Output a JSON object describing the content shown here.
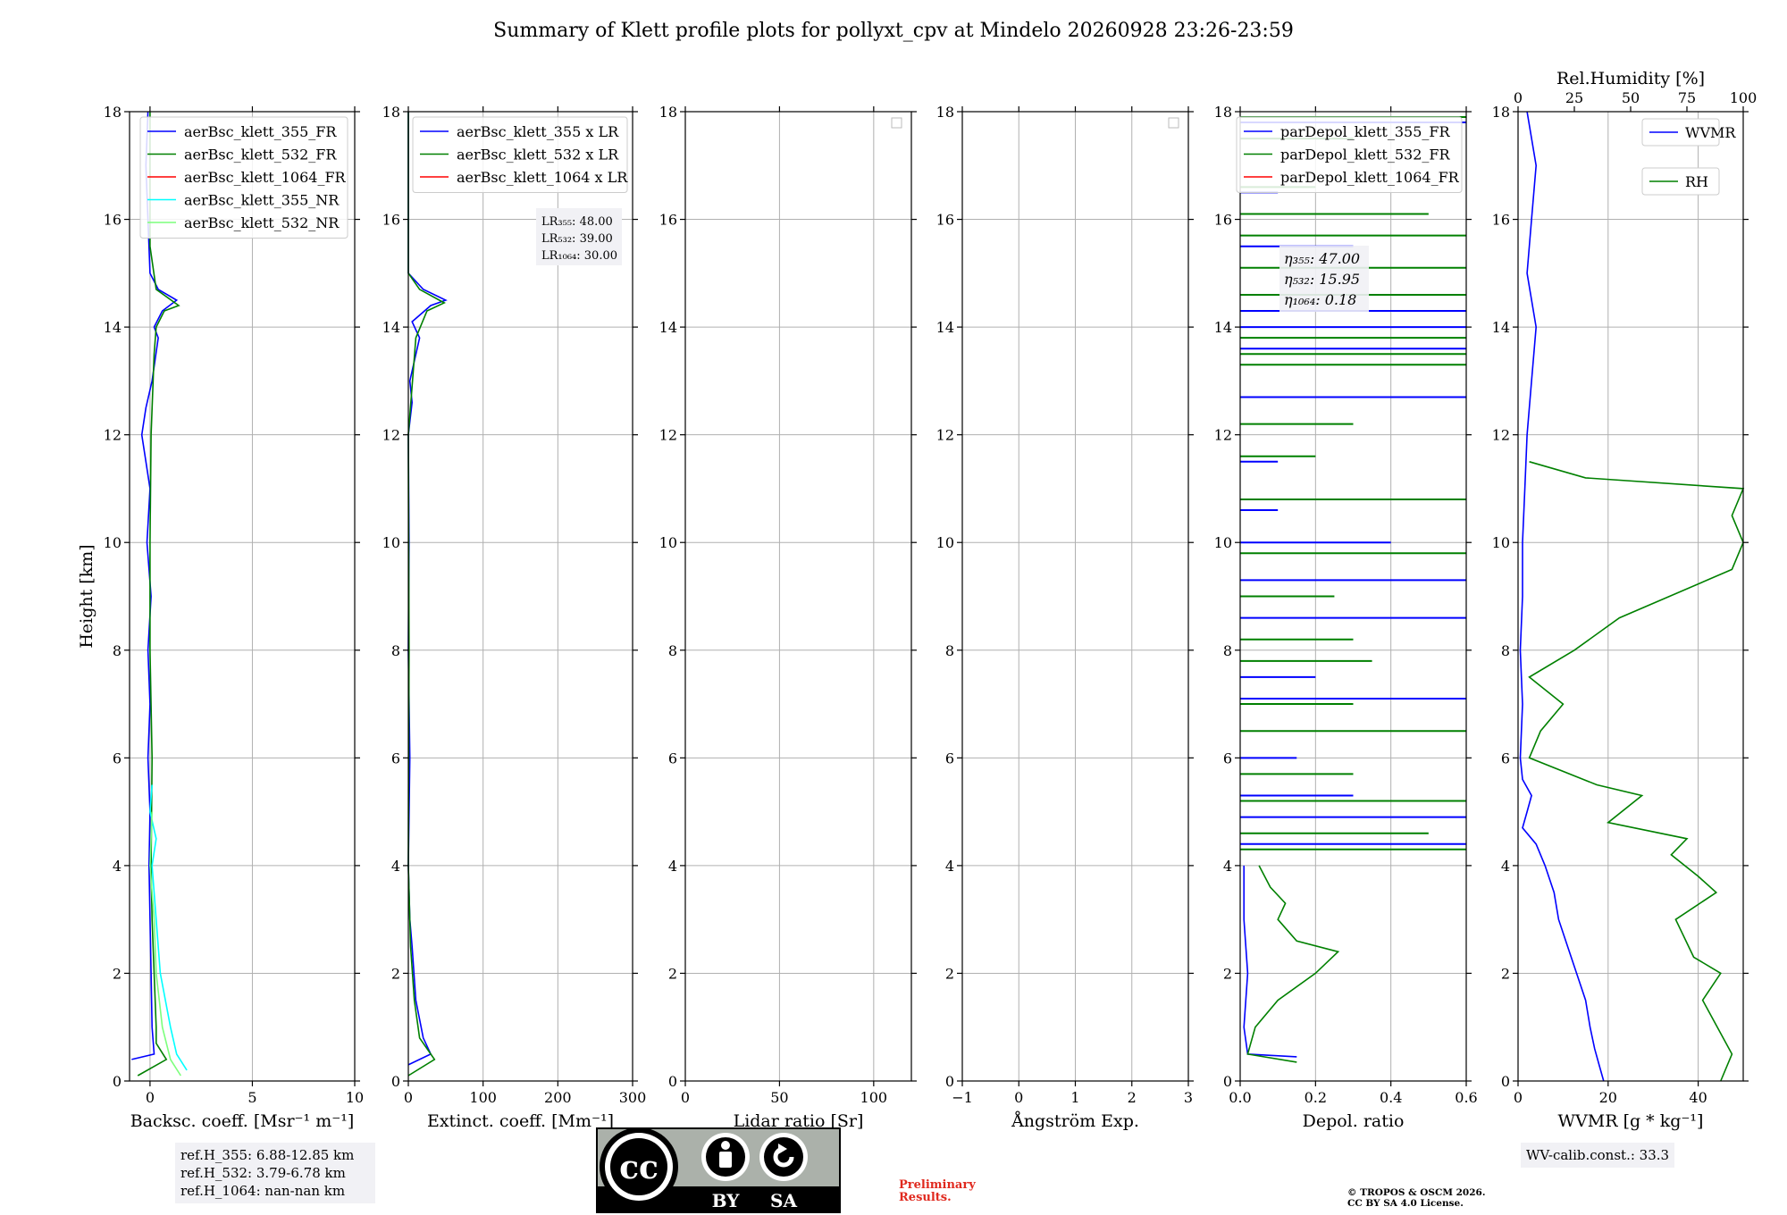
{
  "title": "Summary of Klett profile plots for pollyxt_cpv at Mindelo 20260928 23:26-23:59",
  "ylabel": "Height [km]",
  "chart_data": [
    {
      "type": "line",
      "xlabel": "Backsc. coeff. [Msr⁻¹ m⁻¹]",
      "xlim": [
        -1,
        10
      ],
      "ylim": [
        0,
        18
      ],
      "xticks": [
        "0",
        "5",
        "10"
      ],
      "xtick_values": [
        0,
        5,
        10
      ],
      "yticks": [
        "0",
        "2",
        "4",
        "6",
        "8",
        "10",
        "12",
        "14",
        "16",
        "18"
      ],
      "grid": true,
      "legend_position": "top-right",
      "series": [
        {
          "name": "aerBsc_klett_355_FR",
          "color": "#0000ff",
          "points": [
            [
              -0.9,
              0.4
            ],
            [
              0.2,
              0.5
            ],
            [
              0.1,
              1.0
            ],
            [
              0.05,
              2.0
            ],
            [
              0.0,
              3.0
            ],
            [
              -0.05,
              4.0
            ],
            [
              0.0,
              5.0
            ],
            [
              -0.1,
              6.0
            ],
            [
              0.0,
              7.0
            ],
            [
              -0.1,
              8.0
            ],
            [
              0.05,
              9.0
            ],
            [
              -0.15,
              10.0
            ],
            [
              0.0,
              11.0
            ],
            [
              -0.4,
              12.0
            ],
            [
              -0.2,
              12.5
            ],
            [
              0.1,
              13.0
            ],
            [
              0.4,
              13.8
            ],
            [
              0.2,
              14.0
            ],
            [
              0.6,
              14.3
            ],
            [
              1.3,
              14.5
            ],
            [
              0.4,
              14.7
            ],
            [
              0.0,
              15.0
            ],
            [
              -0.1,
              16.0
            ],
            [
              -0.2,
              17.0
            ],
            [
              -0.1,
              18.0
            ]
          ]
        },
        {
          "name": "aerBsc_klett_532_FR",
          "color": "#008000",
          "points": [
            [
              -0.6,
              0.1
            ],
            [
              0.8,
              0.4
            ],
            [
              0.3,
              0.7
            ],
            [
              0.3,
              1.0
            ],
            [
              0.2,
              2.0
            ],
            [
              0.1,
              3.0
            ],
            [
              0.05,
              4.0
            ],
            [
              0.1,
              6.0
            ],
            [
              0.0,
              8.0
            ],
            [
              0.0,
              10.0
            ],
            [
              0.05,
              12.0
            ],
            [
              0.2,
              13.5
            ],
            [
              0.3,
              14.0
            ],
            [
              0.7,
              14.3
            ],
            [
              1.4,
              14.4
            ],
            [
              0.3,
              14.7
            ],
            [
              0.0,
              15.5
            ],
            [
              0.0,
              18.0
            ]
          ]
        },
        {
          "name": "aerBsc_klett_1064_FR",
          "color": "#ff0000",
          "points": []
        },
        {
          "name": "aerBsc_klett_355_NR",
          "color": "#00ffff",
          "points": [
            [
              1.8,
              0.2
            ],
            [
              1.3,
              0.5
            ],
            [
              1.0,
              1.0
            ],
            [
              0.5,
              2.0
            ],
            [
              0.3,
              3.0
            ],
            [
              0.1,
              4.0
            ],
            [
              0.3,
              4.5
            ],
            [
              0.0,
              5.0
            ],
            [
              0.1,
              5.5
            ]
          ]
        },
        {
          "name": "aerBsc_klett_532_NR",
          "color": "#7cff7c",
          "points": [
            [
              1.5,
              0.1
            ],
            [
              1.0,
              0.4
            ],
            [
              0.6,
              1.0
            ],
            [
              0.3,
              2.0
            ],
            [
              0.2,
              3.0
            ],
            [
              0.0,
              4.0
            ],
            [
              0.1,
              5.0
            ]
          ]
        }
      ],
      "annotation_lines": [
        "ref.H_355: 6.88-12.85 km",
        "ref.H_532: 3.79-6.78 km",
        "ref.H_1064: nan-nan km"
      ]
    },
    {
      "type": "line",
      "xlabel": "Extinct. coeff. [Mm⁻¹]",
      "xlim": [
        0,
        300
      ],
      "ylim": [
        0,
        18
      ],
      "xticks": [
        "0",
        "100",
        "200",
        "300"
      ],
      "xtick_values": [
        0,
        100,
        200,
        300
      ],
      "yticks": [
        "0",
        "2",
        "4",
        "6",
        "8",
        "10",
        "12",
        "14",
        "16",
        "18"
      ],
      "grid": true,
      "legend_position": "top-right",
      "series": [
        {
          "name": "aerBsc_klett_355 x LR",
          "color": "#0000ff",
          "points": [
            [
              0,
              0.3
            ],
            [
              30,
              0.5
            ],
            [
              20,
              0.8
            ],
            [
              10,
              1.5
            ],
            [
              5,
              2.5
            ],
            [
              2,
              3.0
            ],
            [
              0,
              4.0
            ],
            [
              2,
              6.0
            ],
            [
              0,
              8.0
            ],
            [
              1,
              10.0
            ],
            [
              0,
              12.0
            ],
            [
              5,
              12.6
            ],
            [
              2,
              13.0
            ],
            [
              15,
              13.8
            ],
            [
              5,
              14.1
            ],
            [
              30,
              14.4
            ],
            [
              50,
              14.5
            ],
            [
              20,
              14.7
            ],
            [
              0,
              15.0
            ],
            [
              0,
              18.0
            ]
          ]
        },
        {
          "name": "aerBsc_klett_532 x LR",
          "color": "#008000",
          "points": [
            [
              0,
              0.1
            ],
            [
              35,
              0.4
            ],
            [
              15,
              0.8
            ],
            [
              8,
              1.5
            ],
            [
              3,
              2.5
            ],
            [
              0,
              4.0
            ],
            [
              1,
              8.0
            ],
            [
              0,
              12.0
            ],
            [
              10,
              13.8
            ],
            [
              25,
              14.3
            ],
            [
              48,
              14.45
            ],
            [
              15,
              14.7
            ],
            [
              0,
              15.0
            ],
            [
              0,
              18.0
            ]
          ]
        },
        {
          "name": "aerBsc_klett_1064 x LR",
          "color": "#ff0000",
          "points": []
        }
      ],
      "lidar_ratios": [
        "LR₃₅₅: 48.00",
        "LR₅₃₂: 39.00",
        "LR₁₀₆₄: 30.00"
      ]
    },
    {
      "type": "line",
      "xlabel": "Lidar ratio [Sr]",
      "xlim": [
        0,
        120
      ],
      "ylim": [
        0,
        18
      ],
      "xticks": [
        "0",
        "50",
        "100"
      ],
      "xtick_values": [
        0,
        50,
        100
      ],
      "yticks": [
        "0",
        "2",
        "4",
        "6",
        "8",
        "10",
        "12",
        "14",
        "16",
        "18"
      ],
      "grid": true,
      "legend_position": "top-right",
      "series": []
    },
    {
      "type": "line",
      "xlabel": "Ångström Exp.",
      "xlim": [
        -1,
        3
      ],
      "ylim": [
        0,
        18
      ],
      "xticks": [
        "−1",
        "0",
        "1",
        "2",
        "3"
      ],
      "xtick_values": [
        -1,
        0,
        1,
        2,
        3
      ],
      "yticks": [
        "0",
        "2",
        "4",
        "6",
        "8",
        "10",
        "12",
        "14",
        "16",
        "18"
      ],
      "grid": true,
      "legend_position": "top-right",
      "series": []
    },
    {
      "type": "line",
      "xlabel": "Depol. ratio",
      "xlim": [
        0,
        0.6
      ],
      "ylim": [
        0,
        18
      ],
      "xticks": [
        "0.0",
        "0.2",
        "0.4",
        "0.6"
      ],
      "xtick_values": [
        0,
        0.2,
        0.4,
        0.6
      ],
      "yticks": [
        "0",
        "2",
        "4",
        "6",
        "8",
        "10",
        "12",
        "14",
        "16",
        "18"
      ],
      "grid": true,
      "legend_position": "top-right",
      "series": [
        {
          "name": "parDepol_klett_355_FR",
          "color": "#0000ff",
          "points": [
            [
              0.15,
              0.45
            ],
            [
              0.02,
              0.5
            ],
            [
              0.01,
              1.0
            ],
            [
              0.02,
              2.0
            ],
            [
              0.015,
              2.5
            ],
            [
              0.01,
              3.0
            ],
            [
              0.01,
              4.0
            ]
          ],
          "spikes": [
            [
              4.4,
              0.6
            ],
            [
              4.9,
              0.6
            ],
            [
              5.3,
              0.3
            ],
            [
              6.0,
              0.15
            ],
            [
              7.1,
              0.6
            ],
            [
              7.5,
              0.2
            ],
            [
              8.6,
              0.6
            ],
            [
              9.3,
              0.6
            ],
            [
              10.0,
              0.4
            ],
            [
              10.6,
              0.1
            ],
            [
              11.5,
              0.1
            ],
            [
              12.7,
              0.6
            ],
            [
              13.6,
              0.6
            ],
            [
              14.0,
              0.6
            ],
            [
              14.3,
              0.6
            ],
            [
              14.6,
              0.6
            ],
            [
              15.5,
              0.3
            ],
            [
              16.5,
              0.1
            ],
            [
              17.8,
              0.6
            ]
          ]
        },
        {
          "name": "parDepol_klett_532_FR",
          "color": "#008000",
          "points": [
            [
              0.15,
              0.35
            ],
            [
              0.02,
              0.5
            ],
            [
              0.04,
              1.0
            ],
            [
              0.1,
              1.5
            ],
            [
              0.2,
              2.0
            ],
            [
              0.26,
              2.4
            ],
            [
              0.15,
              2.6
            ],
            [
              0.1,
              3.0
            ],
            [
              0.12,
              3.3
            ],
            [
              0.08,
              3.6
            ],
            [
              0.05,
              4.0
            ]
          ],
          "spikes": [
            [
              4.3,
              0.6
            ],
            [
              4.6,
              0.5
            ],
            [
              5.2,
              0.6
            ],
            [
              5.7,
              0.3
            ],
            [
              6.5,
              0.6
            ],
            [
              7.0,
              0.3
            ],
            [
              7.8,
              0.35
            ],
            [
              8.2,
              0.3
            ],
            [
              9.0,
              0.25
            ],
            [
              9.8,
              0.6
            ],
            [
              10.8,
              0.6
            ],
            [
              11.6,
              0.2
            ],
            [
              12.2,
              0.3
            ],
            [
              13.3,
              0.6
            ],
            [
              13.5,
              0.6
            ],
            [
              13.8,
              0.6
            ],
            [
              14.6,
              0.6
            ],
            [
              15.1,
              0.6
            ],
            [
              15.7,
              0.6
            ],
            [
              16.1,
              0.5
            ],
            [
              16.6,
              0.2
            ],
            [
              17.5,
              0.3
            ],
            [
              17.9,
              0.6
            ]
          ]
        },
        {
          "name": "parDepol_klett_1064_FR",
          "color": "#ff0000",
          "points": []
        }
      ],
      "angstrom_labels": [
        "η₃₅₅: 47.00",
        "η₅₃₂: 15.95",
        "η₁₀₆₄: 0.18"
      ]
    },
    {
      "type": "line",
      "xlabel": "WVMR [g * kg⁻¹]",
      "top_xlabel": "Rel.Humidity [%]",
      "xlim": [
        0,
        50
      ],
      "top_xlim": [
        0,
        100
      ],
      "ylim": [
        0,
        18
      ],
      "xticks": [
        "0",
        "20",
        "40"
      ],
      "xtick_values": [
        0,
        20,
        40
      ],
      "top_xticks": [
        "0",
        "25",
        "50",
        "75",
        "100"
      ],
      "top_xtick_values": [
        0,
        25,
        50,
        75,
        100
      ],
      "yticks": [
        "0",
        "2",
        "4",
        "6",
        "8",
        "10",
        "12",
        "14",
        "16",
        "18"
      ],
      "grid": true,
      "legend_position": "top-right",
      "series": [
        {
          "name": "WVMR",
          "color": "#0000ff",
          "axis": "bottom",
          "points": [
            [
              19,
              0.0
            ],
            [
              18,
              0.3
            ],
            [
              17,
              0.6
            ],
            [
              16,
              1.0
            ],
            [
              15,
              1.5
            ],
            [
              13,
              2.0
            ],
            [
              11,
              2.5
            ],
            [
              9,
              3.0
            ],
            [
              8,
              3.5
            ],
            [
              6,
              4.0
            ],
            [
              4,
              4.4
            ],
            [
              1,
              4.7
            ],
            [
              2,
              5.0
            ],
            [
              3,
              5.3
            ],
            [
              1,
              5.6
            ],
            [
              0.5,
              6.0
            ],
            [
              1,
              7.0
            ],
            [
              0.5,
              8.0
            ],
            [
              1,
              9.0
            ],
            [
              1,
              10.0
            ],
            [
              1.5,
              11.0
            ],
            [
              2,
              12.0
            ],
            [
              3,
              13.0
            ],
            [
              4,
              14.0
            ],
            [
              2,
              15.0
            ],
            [
              3,
              16.0
            ],
            [
              4,
              17.0
            ],
            [
              2,
              18.0
            ]
          ]
        },
        {
          "name": "RH",
          "color": "#008000",
          "axis": "top",
          "points": [
            [
              90,
              0.0
            ],
            [
              95,
              0.5
            ],
            [
              82,
              1.5
            ],
            [
              90,
              2.0
            ],
            [
              78,
              2.3
            ],
            [
              70,
              3.0
            ],
            [
              88,
              3.5
            ],
            [
              80,
              3.8
            ],
            [
              68,
              4.2
            ],
            [
              75,
              4.5
            ],
            [
              40,
              4.8
            ],
            [
              55,
              5.3
            ],
            [
              35,
              5.5
            ],
            [
              5,
              6.0
            ],
            [
              10,
              6.5
            ],
            [
              20,
              7.0
            ],
            [
              5,
              7.5
            ],
            [
              25,
              8.0
            ],
            [
              45,
              8.6
            ],
            [
              95,
              9.5
            ],
            [
              100,
              10.0
            ],
            [
              95,
              10.5
            ],
            [
              100,
              11.0
            ],
            [
              30,
              11.2
            ],
            [
              5,
              11.5
            ]
          ]
        }
      ],
      "wv_calib": "WV-calib.const.: 33.3"
    }
  ],
  "footer": {
    "prelim_line1": "Preliminary",
    "prelim_line2": "Results.",
    "copyright_line1": "© TROPOS & OSCM 2026.",
    "copyright_line2": "CC BY SA 4.0 License.",
    "cc_text": "cc",
    "cc_by": "BY",
    "cc_sa": "SA"
  }
}
